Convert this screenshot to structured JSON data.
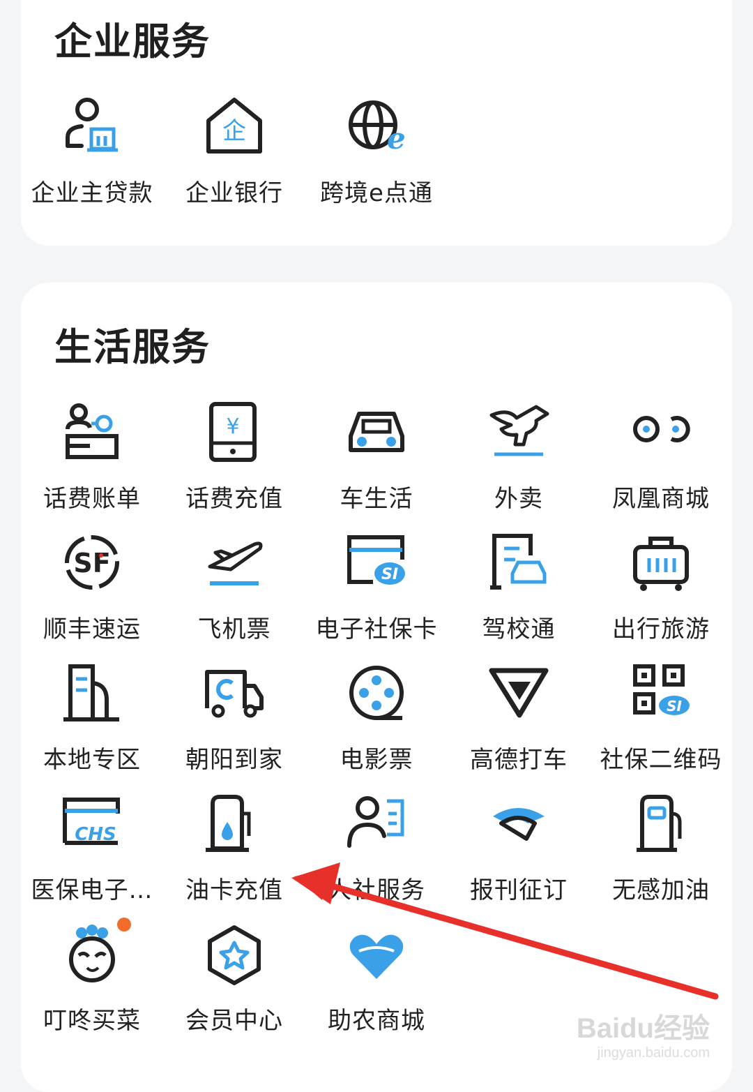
{
  "colors": {
    "ink": "#222222",
    "accent": "#3aa0e8",
    "arrow": "#e8302a",
    "badge": "#f26b2d"
  },
  "enterprise": {
    "title": "企业服务",
    "items": [
      {
        "label": "企业主贷款",
        "icon": "loan-icon"
      },
      {
        "label": "企业银行",
        "icon": "enterprise-bank-icon"
      },
      {
        "label": "跨境e点通",
        "icon": "cross-border-icon"
      }
    ]
  },
  "life": {
    "title": "生活服务",
    "items": [
      {
        "label": "话费账单",
        "icon": "phone-bill-icon"
      },
      {
        "label": "话费充值",
        "icon": "phone-topup-icon"
      },
      {
        "label": "车生活",
        "icon": "car-icon"
      },
      {
        "label": "外卖",
        "icon": "takeout-icon"
      },
      {
        "label": "凤凰商城",
        "icon": "phoenix-mall-icon"
      },
      {
        "label": "顺丰速运",
        "icon": "sf-express-icon"
      },
      {
        "label": "飞机票",
        "icon": "airplane-icon"
      },
      {
        "label": "电子社保卡",
        "icon": "social-security-card-icon"
      },
      {
        "label": "驾校通",
        "icon": "driving-school-icon"
      },
      {
        "label": "出行旅游",
        "icon": "luggage-icon"
      },
      {
        "label": "本地专区",
        "icon": "building-icon"
      },
      {
        "label": "朝阳到家",
        "icon": "delivery-truck-icon"
      },
      {
        "label": "电影票",
        "icon": "film-reel-icon"
      },
      {
        "label": "高德打车",
        "icon": "amap-taxi-icon"
      },
      {
        "label": "社保二维码",
        "icon": "qr-code-icon"
      },
      {
        "label": "医保电子…",
        "icon": "medical-insurance-card-icon"
      },
      {
        "label": "油卡充值",
        "icon": "fuel-card-icon"
      },
      {
        "label": "人社服务",
        "icon": "hr-service-icon"
      },
      {
        "label": "报刊征订",
        "icon": "newspaper-icon"
      },
      {
        "label": "无感加油",
        "icon": "gas-pump-icon"
      },
      {
        "label": "叮咚买菜",
        "icon": "dingdong-icon",
        "badge": true
      },
      {
        "label": "会员中心",
        "icon": "member-star-icon"
      },
      {
        "label": "助农商城",
        "icon": "heart-hands-icon"
      }
    ]
  },
  "watermark": {
    "brand": "Baidu经验",
    "url": "jingyan.baidu.com"
  }
}
